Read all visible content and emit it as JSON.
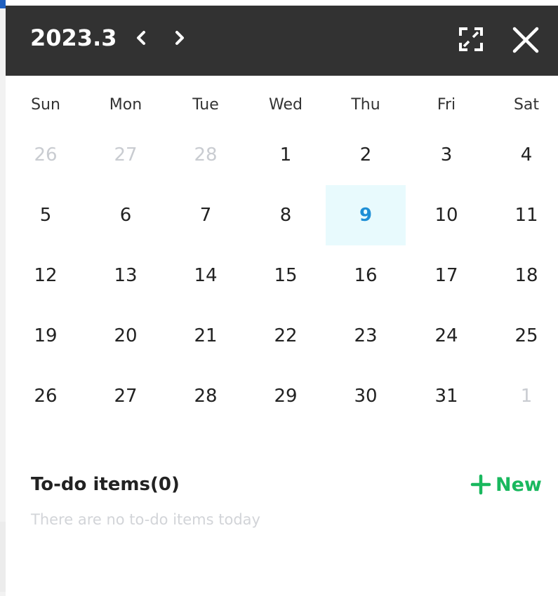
{
  "header": {
    "title": "2023.3",
    "prev_icon": "chevron-left-icon",
    "next_icon": "chevron-right-icon",
    "fullscreen_icon": "fullscreen-icon",
    "close_icon": "close-icon"
  },
  "weekdays": [
    "Sun",
    "Mon",
    "Tue",
    "Wed",
    "Thu",
    "Fri",
    "Sat"
  ],
  "weeks": [
    [
      {
        "day": "26",
        "muted": true
      },
      {
        "day": "27",
        "muted": true
      },
      {
        "day": "28",
        "muted": true
      },
      {
        "day": "1"
      },
      {
        "day": "2"
      },
      {
        "day": "3"
      },
      {
        "day": "4"
      }
    ],
    [
      {
        "day": "5"
      },
      {
        "day": "6"
      },
      {
        "day": "7"
      },
      {
        "day": "8"
      },
      {
        "day": "9",
        "today": true
      },
      {
        "day": "10"
      },
      {
        "day": "11"
      }
    ],
    [
      {
        "day": "12"
      },
      {
        "day": "13"
      },
      {
        "day": "14"
      },
      {
        "day": "15"
      },
      {
        "day": "16"
      },
      {
        "day": "17"
      },
      {
        "day": "18"
      }
    ],
    [
      {
        "day": "19"
      },
      {
        "day": "20"
      },
      {
        "day": "21"
      },
      {
        "day": "22"
      },
      {
        "day": "23"
      },
      {
        "day": "24"
      },
      {
        "day": "25"
      }
    ],
    [
      {
        "day": "26"
      },
      {
        "day": "27"
      },
      {
        "day": "28"
      },
      {
        "day": "29"
      },
      {
        "day": "30"
      },
      {
        "day": "31"
      },
      {
        "day": "1",
        "muted": true
      }
    ]
  ],
  "todo": {
    "title": "To-do items(0)",
    "new_label": "New",
    "new_icon": "plus-icon",
    "empty_text": "There are no to-do items today"
  },
  "colors": {
    "header_bg": "#323232",
    "accent_today": "#1e8fd6",
    "today_bg": "#e8fafd",
    "new_green": "#19b85e"
  }
}
